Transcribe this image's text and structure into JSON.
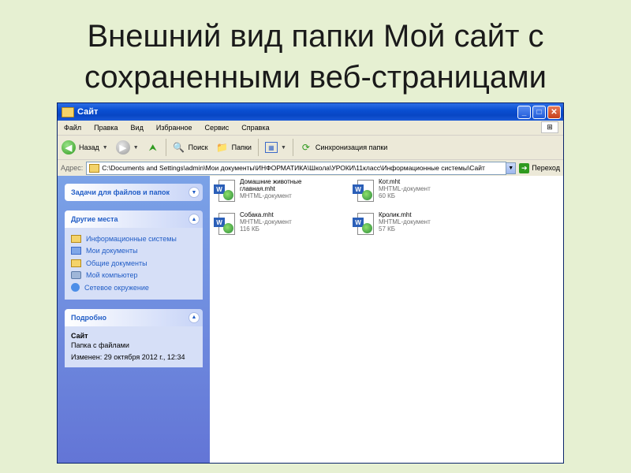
{
  "slide": {
    "title_line1": "Внешний вид папки Мой сайт с",
    "title_line2": "сохраненными веб-страницами"
  },
  "window": {
    "title": "Сайт",
    "minimize_label": "_",
    "maximize_label": "□",
    "close_label": "✕"
  },
  "menu": [
    "Файл",
    "Правка",
    "Вид",
    "Избранное",
    "Сервис",
    "Справка"
  ],
  "toolbar": {
    "back_label": "Назад",
    "search_label": "Поиск",
    "folders_label": "Папки",
    "sync_label": "Синхронизация папки"
  },
  "address": {
    "label": "Адрес:",
    "path": "C:\\Documents and Settings\\admin\\Мои документы\\ИНФОРМАТИКА\\Школа\\УРОКИ\\11класс\\Информационные системы\\Сайт",
    "go_label": "Переход"
  },
  "taskpane": {
    "tasks_header": "Задачи для файлов и папок",
    "places_header": "Другие места",
    "places": [
      {
        "label": "Информационные системы",
        "icon": "folder-icon"
      },
      {
        "label": "Мои документы",
        "icon": "my-documents-icon"
      },
      {
        "label": "Общие документы",
        "icon": "folder-icon"
      },
      {
        "label": "Мой компьютер",
        "icon": "computer-icon"
      },
      {
        "label": "Сетевое окружение",
        "icon": "network-icon"
      }
    ],
    "details_header": "Подробно",
    "details_name": "Сайт",
    "details_type": "Папка с файлами",
    "details_modified": "Изменен: 29 октября 2012 г., 12:34"
  },
  "files": [
    {
      "name_line1": "Домашние животные",
      "name_line2": "главная.mht",
      "type": "MHTML-документ",
      "size": ""
    },
    {
      "name_line1": "Кот.mht",
      "name_line2": "",
      "type": "MHTML-документ",
      "size": "60 КБ"
    },
    {
      "name_line1": "Собака.mht",
      "name_line2": "",
      "type": "MHTML-документ",
      "size": "116 КБ"
    },
    {
      "name_line1": "Кролик.mht",
      "name_line2": "",
      "type": "MHTML-документ",
      "size": "57 КБ"
    }
  ]
}
